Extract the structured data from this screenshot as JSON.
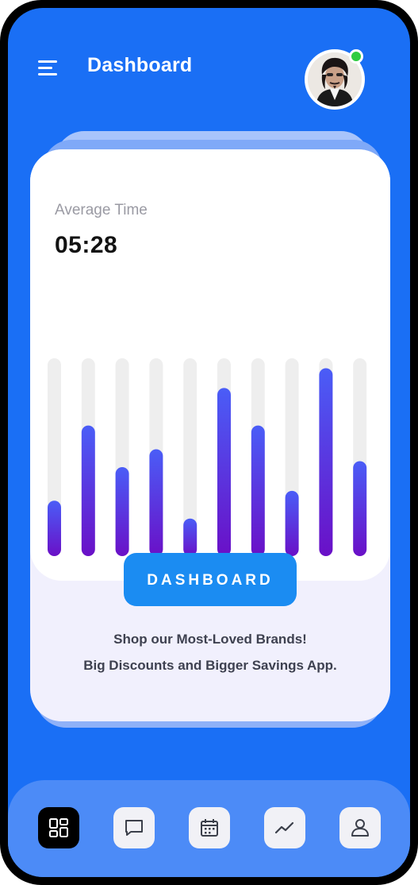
{
  "header": {
    "title": "Dashboard",
    "menu_icon": "menu-icon",
    "avatar_icon": "user-avatar-photo",
    "online_status_color": "#2ecc40"
  },
  "stats_card": {
    "label": "Average Time",
    "value": "05:28"
  },
  "chart_data": {
    "type": "bar",
    "categories": [],
    "values": [
      0.28,
      0.66,
      0.45,
      0.54,
      0.19,
      0.85,
      0.66,
      0.33,
      0.95,
      0.48
    ],
    "ylim": [
      0,
      1
    ],
    "grid": false,
    "bar_gradient": [
      "#4a5df7",
      "#6a10c7"
    ],
    "track_color": "#eeeeee"
  },
  "cta": {
    "button_label": "DASHBOARD",
    "promo_line1": "Shop our Most-Loved Brands!",
    "promo_line2": "Big Discounts and Bigger Savings App."
  },
  "bottom_nav": {
    "items": [
      {
        "icon": "dashboard-grid-icon",
        "active": true
      },
      {
        "icon": "chat-icon",
        "active": false
      },
      {
        "icon": "calendar-icon",
        "active": false
      },
      {
        "icon": "trending-icon",
        "active": false
      },
      {
        "icon": "profile-icon",
        "active": false
      }
    ]
  },
  "colors": {
    "background": "#1a6ff5",
    "accent_button": "#1b8cf2",
    "nav_bar": "#4c8bf7"
  }
}
